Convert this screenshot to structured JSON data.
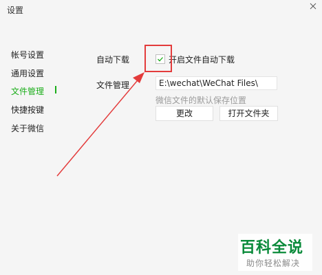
{
  "window": {
    "title": "设置"
  },
  "sidebar": {
    "items": [
      {
        "label": "帐号设置",
        "active": false
      },
      {
        "label": "通用设置",
        "active": false
      },
      {
        "label": "文件管理",
        "active": true
      },
      {
        "label": "快捷按键",
        "active": false
      },
      {
        "label": "关于微信",
        "active": false
      }
    ]
  },
  "content": {
    "auto_download": {
      "label": "自动下载",
      "checkbox_label": "开启文件自动下载",
      "checked": true
    },
    "file_management": {
      "label": "文件管理",
      "path_value": "E:\\wechat\\WeChat Files\\",
      "hint": "微信文件的默认保存位置",
      "change_button": "更改",
      "open_folder_button": "打开文件夹"
    }
  },
  "watermark": {
    "title": "百科全说",
    "subtitle": "助你轻松解决"
  },
  "colors": {
    "accent": "#1aad19",
    "annotation": "#e33b3b"
  }
}
